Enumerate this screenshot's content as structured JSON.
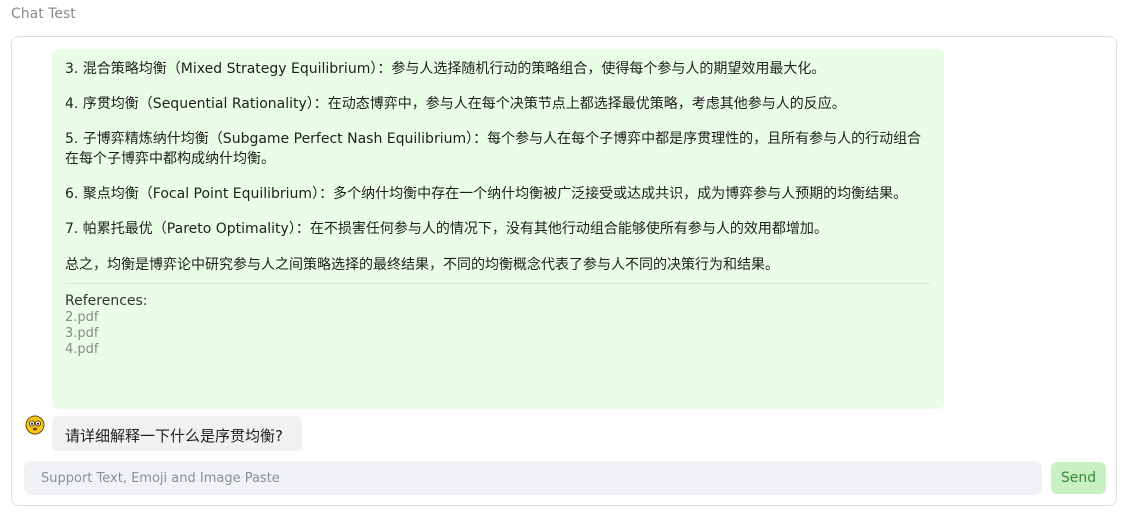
{
  "header": {
    "title": "Chat Test"
  },
  "bot_message": {
    "paragraphs": [
      "3. 混合策略均衡（Mixed Strategy Equilibrium）：参与人选择随机行动的策略组合，使得每个参与人的期望效用最大化。",
      "4. 序贯均衡（Sequential Rationality）：在动态博弈中，参与人在每个决策节点上都选择最优策略，考虑其他参与人的反应。",
      "5. 子博弈精炼纳什均衡（Subgame Perfect Nash Equilibrium）：每个参与人在每个子博弈中都是序贯理性的，且所有参与人的行动组合在每个子博弈中都构成纳什均衡。",
      "6. 聚点均衡（Focal Point Equilibrium）：多个纳什均衡中存在一个纳什均衡被广泛接受或达成共识，成为博弈参与人预期的均衡结果。",
      "7. 帕累托最优（Pareto Optimality）：在不损害任何参与人的情况下，没有其他行动组合能够使所有参与人的效用都增加。",
      "总之，均衡是博弈论中研究参与人之间策略选择的最终结果，不同的均衡概念代表了参与人不同的决策行为和结果。"
    ],
    "references_title": "References:",
    "references": [
      "2.pdf",
      "3.pdf",
      "4.pdf"
    ]
  },
  "user_message": {
    "avatar_icon": "emoji-face-icon",
    "text": "请详细解释一下什么是序贯均衡?"
  },
  "composer": {
    "placeholder": "Support Text, Emoji and Image Paste",
    "value": "",
    "send_label": "Send"
  },
  "colors": {
    "bot_bubble": "#eafde6",
    "user_bubble": "#f1f1f3",
    "send_button": "#c9f0c2",
    "send_text": "#3a8a3a"
  }
}
